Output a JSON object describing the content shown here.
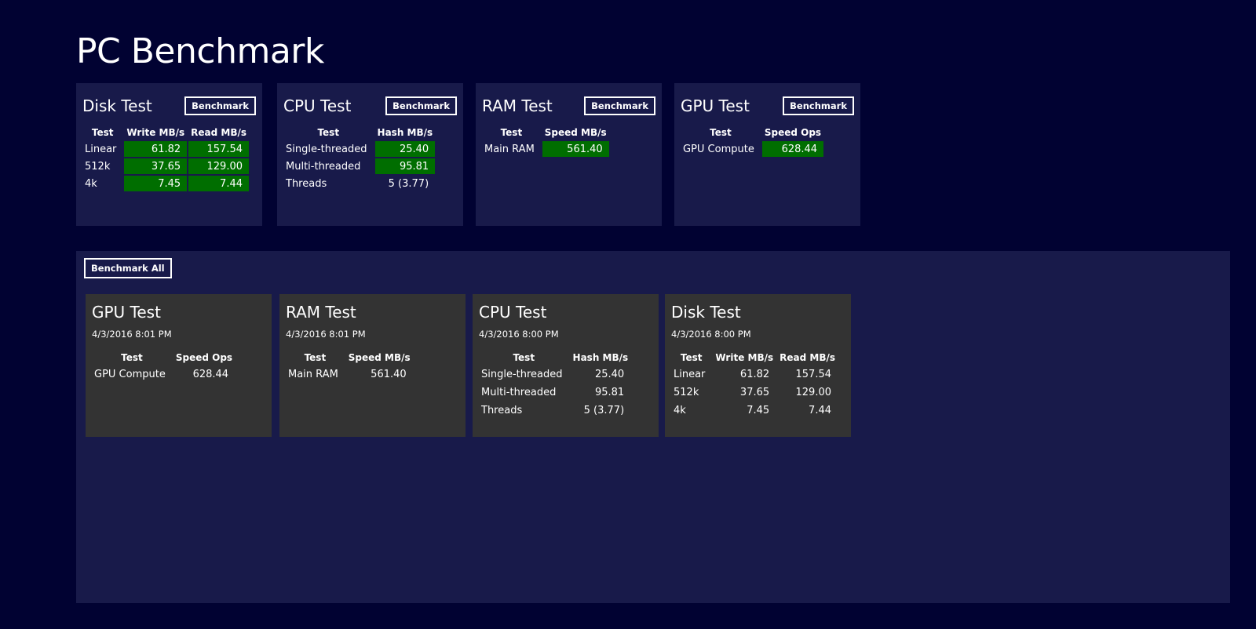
{
  "app": {
    "title": "PC Benchmark"
  },
  "colors": {
    "background": "#010232",
    "panel": "#181a4a",
    "card": "#333333",
    "good": "#006e00"
  },
  "tiles": {
    "disk": {
      "title": "Disk Test",
      "button": "Benchmark",
      "headers": [
        "Test",
        "Write MB/s",
        "Read MB/s"
      ],
      "rows": [
        [
          "Linear",
          "61.82",
          "157.54"
        ],
        [
          "512k",
          "37.65",
          "129.00"
        ],
        [
          "4k",
          "7.45",
          "7.44"
        ]
      ]
    },
    "cpu": {
      "title": "CPU Test",
      "button": "Benchmark",
      "headers": [
        "Test",
        "Hash MB/s"
      ],
      "rows": [
        [
          "Single-threaded",
          "25.40"
        ],
        [
          "Multi-threaded",
          "95.81"
        ],
        [
          "Threads",
          "5 (3.77)"
        ]
      ]
    },
    "ram": {
      "title": "RAM Test",
      "button": "Benchmark",
      "headers": [
        "Test",
        "Speed MB/s"
      ],
      "rows": [
        [
          "Main RAM",
          "561.40"
        ]
      ]
    },
    "gpu": {
      "title": "GPU Test",
      "button": "Benchmark",
      "headers": [
        "Test",
        "Speed Ops"
      ],
      "rows": [
        [
          "GPU Compute",
          "628.44"
        ]
      ]
    }
  },
  "results": {
    "button": "Benchmark All",
    "cards": [
      {
        "title": "GPU Test",
        "date": "4/3/2016 8:01 PM",
        "headers": [
          "Test",
          "Speed Ops"
        ],
        "rows": [
          [
            "GPU Compute",
            "628.44"
          ]
        ]
      },
      {
        "title": "RAM Test",
        "date": "4/3/2016 8:01 PM",
        "headers": [
          "Test",
          "Speed MB/s"
        ],
        "rows": [
          [
            "Main RAM",
            "561.40"
          ]
        ]
      },
      {
        "title": "CPU Test",
        "date": "4/3/2016 8:00 PM",
        "headers": [
          "Test",
          "Hash MB/s"
        ],
        "rows": [
          [
            "Single-threaded",
            "25.40"
          ],
          [
            "Multi-threaded",
            "95.81"
          ],
          [
            "Threads",
            "5 (3.77)"
          ]
        ]
      },
      {
        "title": "Disk Test",
        "date": "4/3/2016 8:00 PM",
        "headers": [
          "Test",
          "Write MB/s",
          "Read MB/s"
        ],
        "rows": [
          [
            "Linear",
            "61.82",
            "157.54"
          ],
          [
            "512k",
            "37.65",
            "129.00"
          ],
          [
            "4k",
            "7.45",
            "7.44"
          ]
        ]
      }
    ]
  }
}
